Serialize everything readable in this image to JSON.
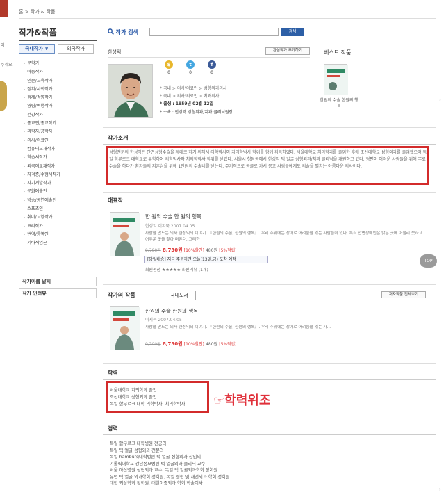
{
  "breadcrumb": {
    "home": "홈",
    "sep": ">",
    "current": "작가 & 작품"
  },
  "edge": {
    "t1": "이",
    "t2": "주세요"
  },
  "sidebar": {
    "title": "작가&작품",
    "tab_domestic": "국내작가 ∨",
    "tab_foreign": "외국작가",
    "categories": [
      "문학가",
      "아동작가",
      "인문/교육작가",
      "정치/사회작가",
      "경제/경영작가",
      "영림/여행작가",
      "건강작가",
      "종교인/종교작가",
      "과학자/공학자",
      "의사/의료인",
      "컴퓨터교재작가",
      "학습서작가",
      "외국어교재작가",
      "자격증/수험서작가",
      "자기계발작가",
      "문화예술인",
      "방송/공연예술인",
      "스포츠인",
      "취미/교양작가",
      "요리작가",
      "번역/통역인",
      "기타직업군"
    ],
    "box1": "작가이름 낱씨",
    "box2": "작가 인터뷰"
  },
  "search": {
    "label": "작가 검색",
    "button": "검색",
    "placeholder": ""
  },
  "author": {
    "name": "한성익",
    "news_button": "관심작가 추가하기",
    "social": [
      {
        "icon": "kakao-icon",
        "glyph": "$",
        "color": "#e8b72c",
        "count": "0"
      },
      {
        "icon": "twitter-icon",
        "glyph": "t",
        "color": "#43a6e0",
        "count": "0"
      },
      {
        "icon": "facebook-icon",
        "glyph": "f",
        "color": "#3b5a98",
        "count": "0"
      }
    ],
    "meta1": "* 국내 > 의사/의료인 > 성형외과의사",
    "meta2": "* 국내 > 의사/의료인 > 치과의사",
    "birth": "* 출생 : 1959년 02월 12일",
    "affil": "* 소속 : 한성익 성형외과/치과 클리닉원장"
  },
  "best": {
    "title": "베스트 작품",
    "caption": "한원의 수술 한원의 행복"
  },
  "intro": {
    "title": "작가소개",
    "text": "성형전문의 한성익은 안면성형수술을 제대로 하기 위해서 의학박사와 치의학박사 학위를 함께 취득하였다. 서울대학교 치의학과를 졸업한 후에 조선대학교 성형외과를 졸업했으며 독일 함부르크 대학교로 유학하여 의학박사와 치의학박사 학위를 받았다. 서울시 청담동에서 한성익 턱 얼굴 성형외과/치과 클리닉을 개원하고 있다. 형편이 어려운 사람들을 위해 무료수술을 하다가 환자들의 지혼심을 위해 1만원의 수술비를 받는다. 주기적으로 몽골로 가서 몽고 사람들에게도 의술을 펼치는 아름다운 의사이다."
  },
  "rep": {
    "title": "대표작",
    "book_title": "한 원의 수술 한 원의 행복",
    "author_line": "한성익 이지북 2007.04.05",
    "desc": "사람을 만드는 의사 한성익의 이야기. 『한원의 수술, 한원의 행복』. 우리 주위에는 장애로 어려움을 겪는 사람들이 있다. 특히 안면장애인은 밝은 곳에 어울리 못하고 어두운 곳을 찾아 떠돈다. 그러한",
    "price_old": "9,700원",
    "price": "8,730원",
    "discount": "[10%할인]",
    "points": "480원",
    "point_rate": "[5%적립]",
    "delivery": "[당일배송] 지금 주문하면 오늘(13일,금) 도착 예정",
    "rating": "회원평점 ★★★★★ 회원리뷰 (1개)"
  },
  "works": {
    "title": "작가의 작품",
    "tab": "국내도서",
    "all_button": "저자작품 전체보기",
    "book_title": "한원의 수술 한원의 행복",
    "author_line": "이지북 2007.04.05",
    "desc": "사람을 만드는 의사 한성익의 이야기. 『한원의 수술, 한원의 행복』. 우리 주위에는 장애로 어려움을 겪는 사...",
    "price_old": "9,700원",
    "price": "8,730원",
    "discount": "[10%할인]",
    "points": "480원",
    "point_rate": "[5%적립]"
  },
  "education": {
    "title": "학력",
    "items": [
      "서울대학교 치의학과 졸업",
      "조선대학교 성형외과 졸업",
      "독일 함부르크 대학 의학박사, 치의학박사"
    ],
    "annotation": "☞학력위조"
  },
  "career": {
    "title": "경력",
    "items": [
      "독일 함부르크 대학병원 전공의",
      "독일 턱 얼굴 성형외과 전문의",
      "독일 hamburg대학병원 턱 얼굴 성형외과 상임의",
      "기톨릭대학교 강남성모병원 턱 얼굴외과 클리닉 교수",
      "서울 아산병원 성형외과 교수, 독일 턱 얼굴외과학회 정회원",
      "유럽 턱 얼굴 외과학회 정회원, 독일 성형 및 재건외과 학회 정회원",
      "대한 외상학회 정회원, 대한이증외과 학회 학술이사"
    ]
  },
  "top_button": "TOP",
  "colors": {
    "accent": "#2d5fa6",
    "red_box": "#d32b2b"
  }
}
